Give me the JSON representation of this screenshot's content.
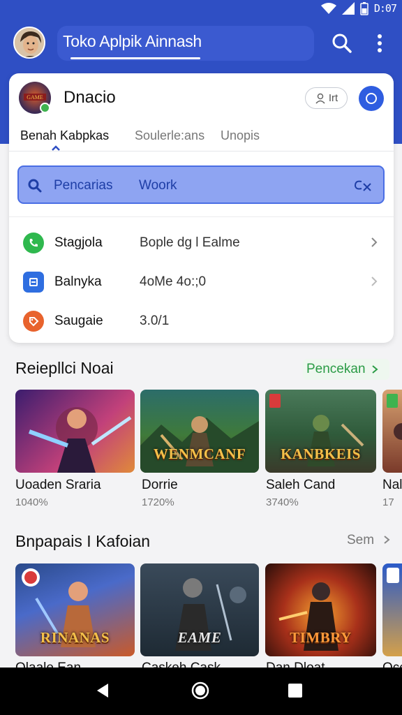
{
  "status_bar": {
    "time": "D:07"
  },
  "app_bar": {
    "title": "Toko Aplpik Ainnash"
  },
  "card": {
    "app_name": "Dnacio",
    "user_pill_label": "Irt",
    "tabs": [
      {
        "label": "Benah Kabpkas",
        "active": true
      },
      {
        "label": "Soulerle:ans",
        "active": false
      },
      {
        "label": "Unopis",
        "active": false
      }
    ],
    "search": {
      "placeholder": "Pencarias",
      "value": "Woork"
    },
    "rows": [
      {
        "label": "Stagjola",
        "value": "Bople dg l Ealme",
        "icon": "phone-icon",
        "color": "#2fb84e"
      },
      {
        "label": "Balnyka",
        "value": "4oMe 4o:;0",
        "icon": "square-icon",
        "color": "#2f6ee0"
      },
      {
        "label": "Saugaie",
        "value": "3.0/1",
        "icon": "tag-icon",
        "color": "#e8632d"
      }
    ]
  },
  "section1": {
    "title": "Reiepllci Noai",
    "link": "Pencekan",
    "items": [
      {
        "name": "Uoaden Sraria",
        "meta": "1040%",
        "caption": ""
      },
      {
        "name": "Dorrie",
        "meta": "1720%",
        "caption": "WENMCANF"
      },
      {
        "name": "Saleh Cand",
        "meta": "3740%",
        "caption": "KANBKEIS"
      },
      {
        "name": "Nal",
        "meta": "17",
        "caption": ""
      }
    ]
  },
  "section2": {
    "title": "Bnpapais I Kafoian",
    "link": "Sem",
    "items": [
      {
        "name": "Olaale Ean",
        "caption": "RINANAS"
      },
      {
        "name": "Caskeh Cask",
        "caption": "EAME"
      },
      {
        "name": "Dan Dloat",
        "caption": "TIMBRY"
      },
      {
        "name": "Oce",
        "caption": ""
      }
    ]
  },
  "colors": {
    "primary": "#2f4fc4",
    "accent_green": "#2a9b45",
    "search_bg": "#8ea4f2"
  }
}
